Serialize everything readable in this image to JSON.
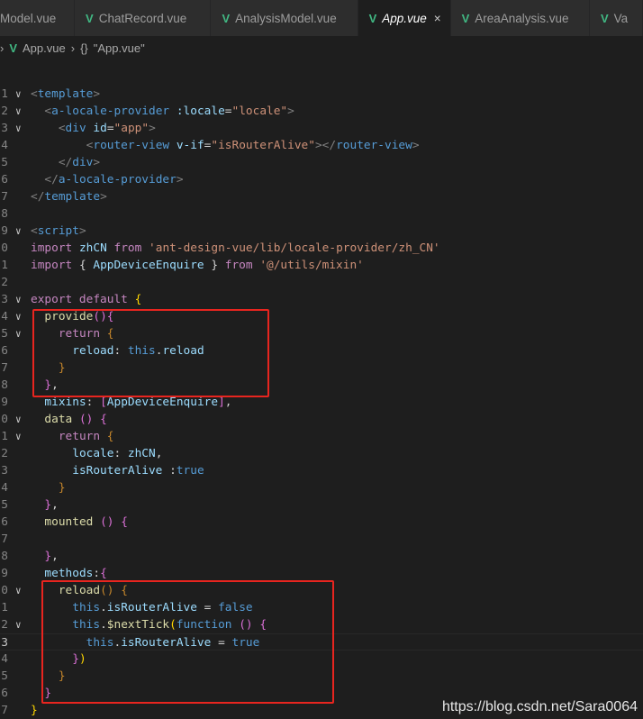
{
  "tabs": [
    {
      "label": "Model.vue",
      "active": false,
      "icon": false
    },
    {
      "label": "ChatRecord.vue",
      "active": false,
      "icon": true
    },
    {
      "label": "AnalysisModel.vue",
      "active": false,
      "icon": true
    },
    {
      "label": "App.vue",
      "active": true,
      "icon": true
    },
    {
      "label": "AreaAnalysis.vue",
      "active": false,
      "icon": true
    },
    {
      "label": "Va",
      "active": false,
      "icon": true
    }
  ],
  "breadcrumb": {
    "file": "App.vue",
    "symbol": "\"App.vue\"",
    "symbol_icon": "{}"
  },
  "icons": {
    "vue": "V",
    "close": "×",
    "fold": "∨",
    "sep": "›"
  },
  "watermark": "https://blog.csdn.net/Sara0064",
  "colors": {
    "highlight_box": "#e8251f",
    "vue_icon": "#41b883"
  },
  "lines": [
    {
      "n": "1",
      "fold": true,
      "t": [
        [
          "tag",
          "<"
        ],
        [
          "name",
          "template"
        ],
        [
          "tag",
          ">"
        ]
      ]
    },
    {
      "n": "2",
      "fold": true,
      "t": [
        [
          "p",
          "  "
        ],
        [
          "tag",
          "<"
        ],
        [
          "name",
          "a-locale-provider"
        ],
        [
          "p",
          " "
        ],
        [
          "attr",
          ":locale"
        ],
        [
          "p",
          "="
        ],
        [
          "str",
          "\"locale\""
        ],
        [
          "tag",
          ">"
        ]
      ]
    },
    {
      "n": "3",
      "fold": true,
      "t": [
        [
          "p",
          "    "
        ],
        [
          "tag",
          "<"
        ],
        [
          "name",
          "div"
        ],
        [
          "p",
          " "
        ],
        [
          "attr",
          "id"
        ],
        [
          "p",
          "="
        ],
        [
          "str",
          "\"app\""
        ],
        [
          "tag",
          ">"
        ]
      ]
    },
    {
      "n": "4",
      "t": [
        [
          "p",
          "        "
        ],
        [
          "tag",
          "<"
        ],
        [
          "name",
          "router-view"
        ],
        [
          "p",
          " "
        ],
        [
          "attr",
          "v-if"
        ],
        [
          "p",
          "="
        ],
        [
          "str",
          "\"isRouterAlive\""
        ],
        [
          "tag",
          "></"
        ],
        [
          "name",
          "router-view"
        ],
        [
          "tag",
          ">"
        ]
      ]
    },
    {
      "n": "5",
      "t": [
        [
          "p",
          "    "
        ],
        [
          "tag",
          "</"
        ],
        [
          "name",
          "div"
        ],
        [
          "tag",
          ">"
        ]
      ]
    },
    {
      "n": "6",
      "t": [
        [
          "p",
          "  "
        ],
        [
          "tag",
          "</"
        ],
        [
          "name",
          "a-locale-provider"
        ],
        [
          "tag",
          ">"
        ]
      ]
    },
    {
      "n": "7",
      "t": [
        [
          "tag",
          "</"
        ],
        [
          "name",
          "template"
        ],
        [
          "tag",
          ">"
        ]
      ]
    },
    {
      "n": "8",
      "t": []
    },
    {
      "n": "9",
      "fold": true,
      "t": [
        [
          "tag",
          "<"
        ],
        [
          "name",
          "script"
        ],
        [
          "tag",
          ">"
        ]
      ]
    },
    {
      "n": "0",
      "t": [
        [
          "kw",
          "import"
        ],
        [
          "p",
          " "
        ],
        [
          "id",
          "zhCN"
        ],
        [
          "p",
          " "
        ],
        [
          "kw",
          "from"
        ],
        [
          "p",
          " "
        ],
        [
          "str",
          "'ant-design-vue/lib/locale-provider/zh_CN'"
        ]
      ]
    },
    {
      "n": "1",
      "t": [
        [
          "kw",
          "import"
        ],
        [
          "p",
          " { "
        ],
        [
          "id",
          "AppDeviceEnquire"
        ],
        [
          "p",
          " } "
        ],
        [
          "kw",
          "from"
        ],
        [
          "p",
          " "
        ],
        [
          "str",
          "'@/utils/mixin'"
        ]
      ]
    },
    {
      "n": "2",
      "t": []
    },
    {
      "n": "3",
      "fold": true,
      "t": [
        [
          "kw",
          "export default"
        ],
        [
          "p",
          " "
        ],
        [
          "br",
          "{"
        ]
      ]
    },
    {
      "n": "4",
      "fold": true,
      "t": [
        [
          "p",
          "  "
        ],
        [
          "fn",
          "provide"
        ],
        [
          "br2",
          "()"
        ],
        [
          "br2",
          "{"
        ]
      ]
    },
    {
      "n": "5",
      "fold": true,
      "t": [
        [
          "p",
          "    "
        ],
        [
          "kw",
          "return"
        ],
        [
          "p",
          " "
        ],
        [
          "br3",
          "{"
        ]
      ]
    },
    {
      "n": "6",
      "t": [
        [
          "p",
          "      "
        ],
        [
          "id",
          "reload"
        ],
        [
          "p",
          ": "
        ],
        [
          "this",
          "this"
        ],
        [
          "p",
          "."
        ],
        [
          "id",
          "reload"
        ]
      ]
    },
    {
      "n": "7",
      "t": [
        [
          "p",
          "    "
        ],
        [
          "br3",
          "}"
        ]
      ]
    },
    {
      "n": "8",
      "t": [
        [
          "p",
          "  "
        ],
        [
          "br2",
          "}"
        ],
        [
          "p",
          ","
        ]
      ]
    },
    {
      "n": "9",
      "t": [
        [
          "p",
          "  "
        ],
        [
          "id",
          "mixins"
        ],
        [
          "p",
          ": "
        ],
        [
          "br2",
          "["
        ],
        [
          "id",
          "AppDeviceEnquire"
        ],
        [
          "br2",
          "]"
        ],
        [
          "p",
          ","
        ]
      ]
    },
    {
      "n": "0",
      "fold": true,
      "t": [
        [
          "p",
          "  "
        ],
        [
          "fn",
          "data"
        ],
        [
          "p",
          " "
        ],
        [
          "br2",
          "()"
        ],
        [
          "p",
          " "
        ],
        [
          "br2",
          "{"
        ]
      ]
    },
    {
      "n": "1",
      "fold": true,
      "t": [
        [
          "p",
          "    "
        ],
        [
          "kw",
          "return"
        ],
        [
          "p",
          " "
        ],
        [
          "br3",
          "{"
        ]
      ]
    },
    {
      "n": "2",
      "t": [
        [
          "p",
          "      "
        ],
        [
          "id",
          "locale"
        ],
        [
          "p",
          ": "
        ],
        [
          "id",
          "zhCN"
        ],
        [
          "p",
          ","
        ]
      ]
    },
    {
      "n": "3",
      "t": [
        [
          "p",
          "      "
        ],
        [
          "id",
          "isRouterAlive"
        ],
        [
          "p",
          " :"
        ],
        [
          "this",
          "true"
        ]
      ]
    },
    {
      "n": "4",
      "t": [
        [
          "p",
          "    "
        ],
        [
          "br3",
          "}"
        ]
      ]
    },
    {
      "n": "5",
      "t": [
        [
          "p",
          "  "
        ],
        [
          "br2",
          "}"
        ],
        [
          "p",
          ","
        ]
      ]
    },
    {
      "n": "6",
      "t": [
        [
          "p",
          "  "
        ],
        [
          "fn",
          "mounted"
        ],
        [
          "p",
          " "
        ],
        [
          "br2",
          "()"
        ],
        [
          "p",
          " "
        ],
        [
          "br2",
          "{"
        ]
      ]
    },
    {
      "n": "7",
      "t": []
    },
    {
      "n": "8",
      "t": [
        [
          "p",
          "  "
        ],
        [
          "br2",
          "}"
        ],
        [
          "p",
          ","
        ]
      ]
    },
    {
      "n": "9",
      "t": [
        [
          "p",
          "  "
        ],
        [
          "id",
          "methods"
        ],
        [
          "p",
          ":"
        ],
        [
          "br2",
          "{"
        ]
      ]
    },
    {
      "n": "0",
      "fold": true,
      "t": [
        [
          "p",
          "    "
        ],
        [
          "fn",
          "reload"
        ],
        [
          "br3",
          "()"
        ],
        [
          "p",
          " "
        ],
        [
          "br3",
          "{"
        ]
      ]
    },
    {
      "n": "1",
      "t": [
        [
          "p",
          "      "
        ],
        [
          "this",
          "this"
        ],
        [
          "p",
          "."
        ],
        [
          "id",
          "isRouterAlive"
        ],
        [
          "p",
          " = "
        ],
        [
          "this",
          "false"
        ]
      ]
    },
    {
      "n": "2",
      "fold": true,
      "t": [
        [
          "p",
          "      "
        ],
        [
          "this",
          "this"
        ],
        [
          "p",
          "."
        ],
        [
          "fn",
          "$nextTick"
        ],
        [
          "br",
          "("
        ],
        [
          "this",
          "function"
        ],
        [
          "p",
          " "
        ],
        [
          "br2",
          "()"
        ],
        [
          "p",
          " "
        ],
        [
          "br2",
          "{"
        ]
      ]
    },
    {
      "n": "3",
      "current": true,
      "t": [
        [
          "p",
          "        "
        ],
        [
          "this",
          "this"
        ],
        [
          "p",
          "."
        ],
        [
          "id",
          "isRouterAlive"
        ],
        [
          "p",
          " = "
        ],
        [
          "this",
          "true"
        ]
      ]
    },
    {
      "n": "4",
      "t": [
        [
          "p",
          "      "
        ],
        [
          "br2",
          "}"
        ],
        [
          "br",
          ")"
        ]
      ]
    },
    {
      "n": "5",
      "t": [
        [
          "p",
          "    "
        ],
        [
          "br3",
          "}"
        ]
      ]
    },
    {
      "n": "6",
      "t": [
        [
          "p",
          "  "
        ],
        [
          "br2",
          "}"
        ]
      ]
    },
    {
      "n": "7",
      "t": [
        [
          "br",
          "}"
        ]
      ]
    }
  ]
}
